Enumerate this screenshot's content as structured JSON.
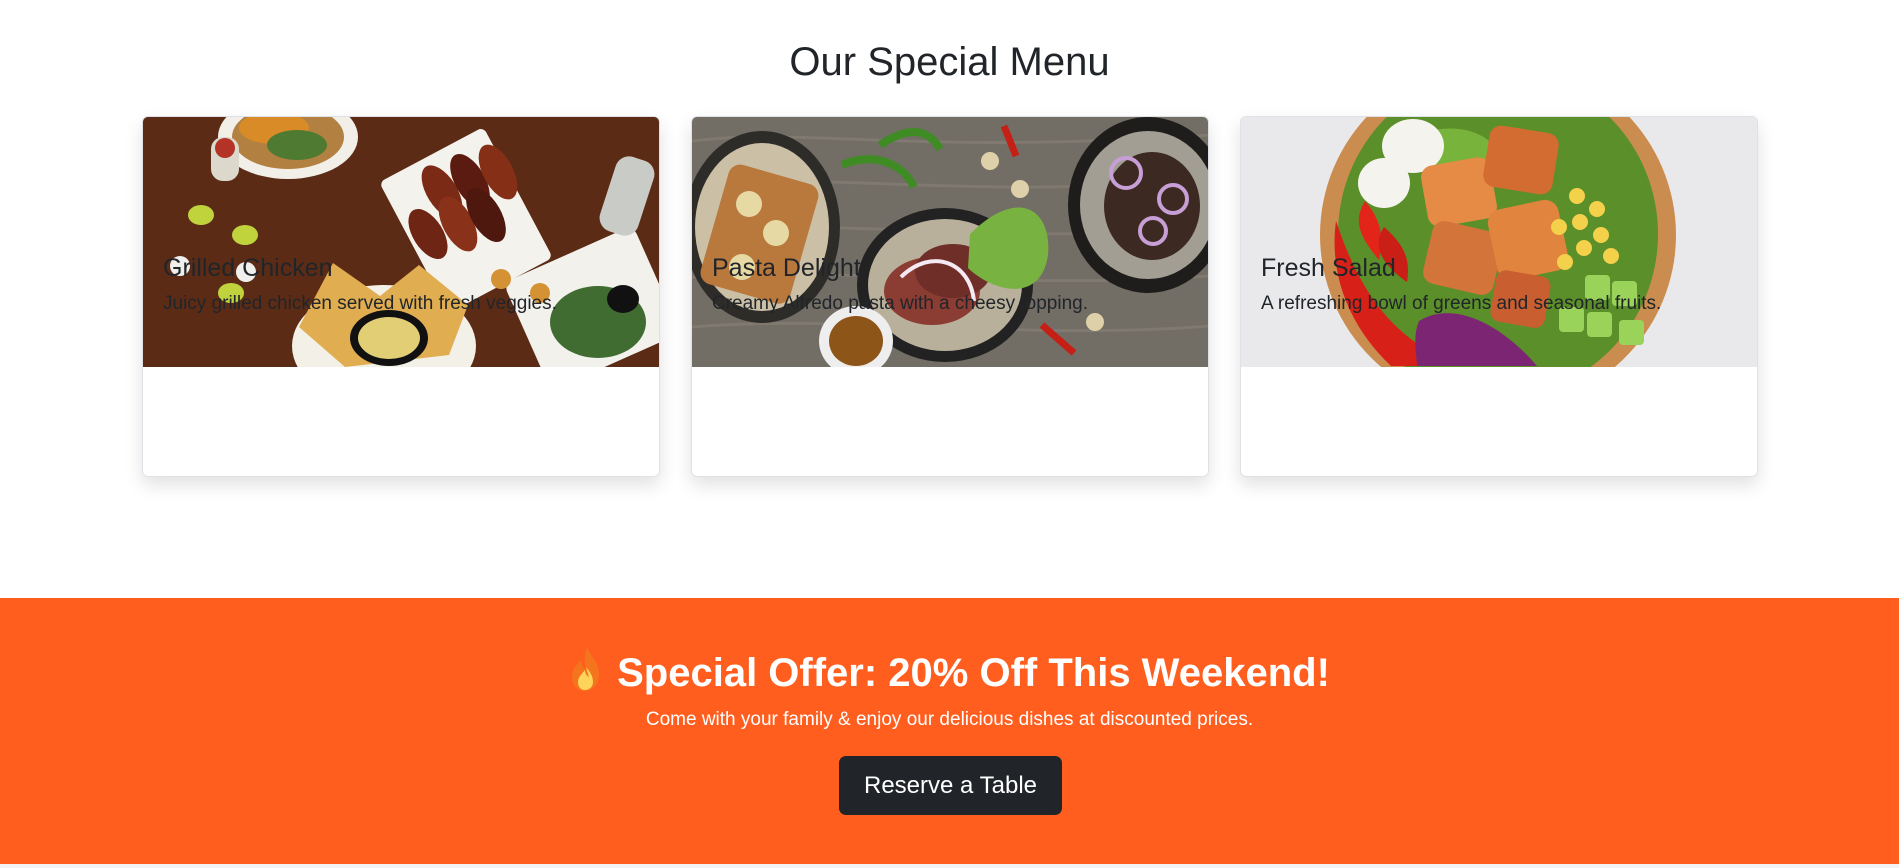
{
  "menu": {
    "title": "Our Special Menu",
    "items": [
      {
        "title": "Grilled Chicken",
        "description": "Juicy grilled chicken served with fresh veggies."
      },
      {
        "title": "Pasta Delight",
        "description": "Creamy Alfredo pasta with a cheesy topping."
      },
      {
        "title": "Fresh Salad",
        "description": "A refreshing bowl of greens and seasonal fruits."
      }
    ]
  },
  "offer": {
    "icon": "flame-icon",
    "heading": "Special Offer: 20% Off This Weekend!",
    "subtitle": "Come with your family & enjoy our delicious dishes at discounted prices.",
    "button_label": "Reserve a Table"
  },
  "colors": {
    "offer_background": "#ff5e1f",
    "button_background": "#212529",
    "text": "#212529"
  }
}
